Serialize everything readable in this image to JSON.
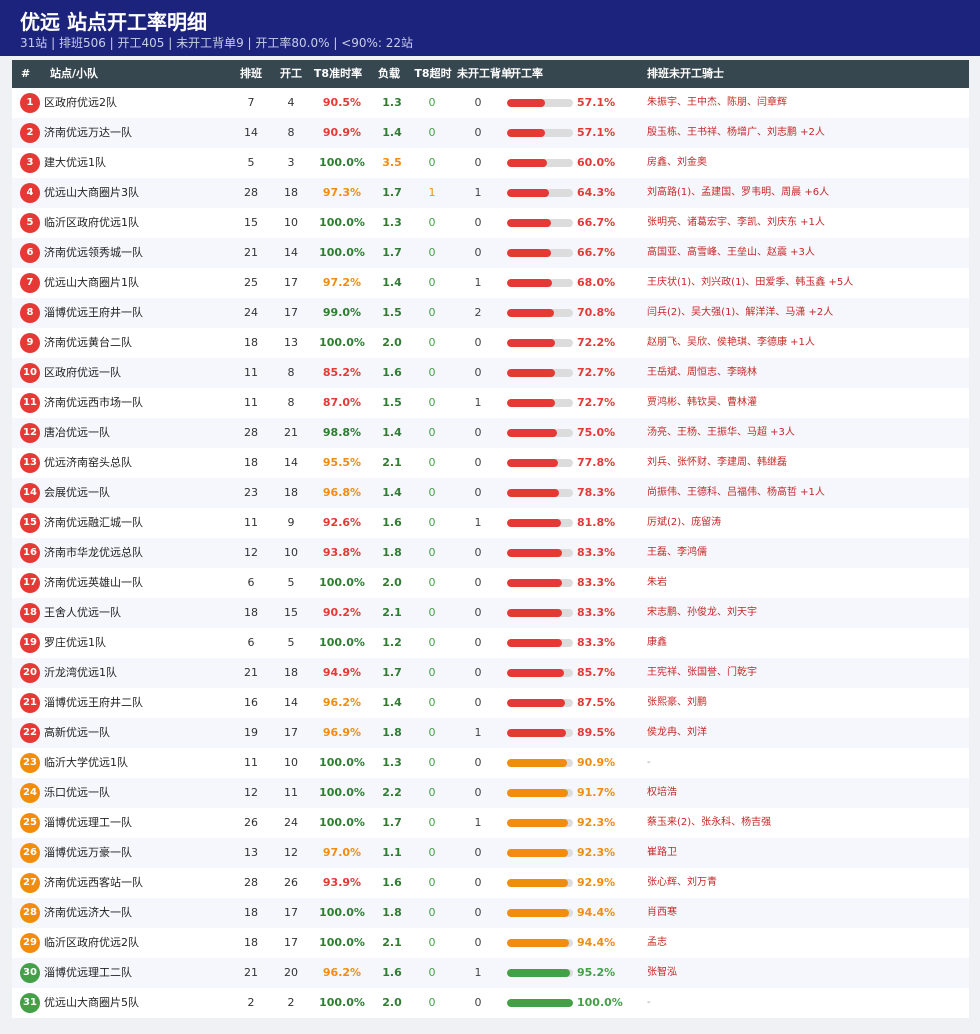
{
  "header": {
    "title": "优远  站点开工率明细",
    "subtitle": "31站 | 排班506 | 开工405 | 未开工背单9 | 开工率80.0% | <90%: 22站"
  },
  "columns": [
    "#",
    "站点/小队",
    "排班",
    "开工",
    "T8准时率",
    "负载",
    "T8超时",
    "未开工背单",
    "开工率",
    "排班未开工骑士"
  ],
  "colors": {
    "red": "#e53935",
    "orange": "#f28c0f",
    "green": "#43a047",
    "dark_green": "#2e7d32",
    "header_bg": "#1b237c",
    "thead_bg": "#37474f"
  },
  "rows": [
    {
      "rank": "1",
      "name": "区政府优远2队",
      "shift": "7",
      "start": "4",
      "t8": "90.5%",
      "load": "1.3",
      "over": "0",
      "nostart": "0",
      "rate": "57.1%",
      "rate_value": 57.1,
      "riders": "朱振宇、王中杰、陈朋、闫章辉"
    },
    {
      "rank": "2",
      "name": "济南优远万达一队",
      "shift": "14",
      "start": "8",
      "t8": "90.9%",
      "load": "1.4",
      "over": "0",
      "nostart": "0",
      "rate": "57.1%",
      "rate_value": 57.1,
      "riders": "殷玉栋、王书祥、杨增广、刘志鹏 +2人"
    },
    {
      "rank": "3",
      "name": "建大优远1队",
      "shift": "5",
      "start": "3",
      "t8": "100.0%",
      "load": "3.5",
      "over": "0",
      "nostart": "0",
      "rate": "60.0%",
      "rate_value": 60.0,
      "riders": "房鑫、刘金奥"
    },
    {
      "rank": "4",
      "name": "优远山大商圈片3队",
      "shift": "28",
      "start": "18",
      "t8": "97.3%",
      "load": "1.7",
      "over": "1",
      "nostart": "1",
      "rate": "64.3%",
      "rate_value": 64.3,
      "riders": "刘高路(1)、孟建国、罗韦明、周晨 +6人"
    },
    {
      "rank": "5",
      "name": "临沂区政府优远1队",
      "shift": "15",
      "start": "10",
      "t8": "100.0%",
      "load": "1.3",
      "over": "0",
      "nostart": "0",
      "rate": "66.7%",
      "rate_value": 66.7,
      "riders": "张明亮、诸葛宏宇、李凯、刘庆东 +1人"
    },
    {
      "rank": "6",
      "name": "济南优远领秀城一队",
      "shift": "21",
      "start": "14",
      "t8": "100.0%",
      "load": "1.7",
      "over": "0",
      "nostart": "0",
      "rate": "66.7%",
      "rate_value": 66.7,
      "riders": "高国亚、高雪峰、王垒山、赵震 +3人"
    },
    {
      "rank": "7",
      "name": "优远山大商圈片1队",
      "shift": "25",
      "start": "17",
      "t8": "97.2%",
      "load": "1.4",
      "over": "0",
      "nostart": "1",
      "rate": "68.0%",
      "rate_value": 68.0,
      "riders": "王庆状(1)、刘兴政(1)、田爱季、韩玉鑫 +5人"
    },
    {
      "rank": "8",
      "name": "淄博优远王府井一队",
      "shift": "24",
      "start": "17",
      "t8": "99.0%",
      "load": "1.5",
      "over": "0",
      "nostart": "2",
      "rate": "70.8%",
      "rate_value": 70.8,
      "riders": "闫兵(2)、吴大强(1)、解洋洋、马潇 +2人"
    },
    {
      "rank": "9",
      "name": "济南优远黄台二队",
      "shift": "18",
      "start": "13",
      "t8": "100.0%",
      "load": "2.0",
      "over": "0",
      "nostart": "0",
      "rate": "72.2%",
      "rate_value": 72.2,
      "riders": "赵朋飞、吴欣、侯艳琪、李德康 +1人"
    },
    {
      "rank": "10",
      "name": "区政府优远一队",
      "shift": "11",
      "start": "8",
      "t8": "85.2%",
      "load": "1.6",
      "over": "0",
      "nostart": "0",
      "rate": "72.7%",
      "rate_value": 72.7,
      "riders": "王岳斌、周恒志、李晓林"
    },
    {
      "rank": "11",
      "name": "济南优远西市场一队",
      "shift": "11",
      "start": "8",
      "t8": "87.0%",
      "load": "1.5",
      "over": "0",
      "nostart": "1",
      "rate": "72.7%",
      "rate_value": 72.7,
      "riders": "贾鸿彬、韩钦昊、曹林灌"
    },
    {
      "rank": "12",
      "name": "唐冶优远一队",
      "shift": "28",
      "start": "21",
      "t8": "98.8%",
      "load": "1.4",
      "over": "0",
      "nostart": "0",
      "rate": "75.0%",
      "rate_value": 75.0,
      "riders": "汤亮、王杨、王振华、马超 +3人"
    },
    {
      "rank": "13",
      "name": "优远济南窑头总队",
      "shift": "18",
      "start": "14",
      "t8": "95.5%",
      "load": "2.1",
      "over": "0",
      "nostart": "0",
      "rate": "77.8%",
      "rate_value": 77.8,
      "riders": "刘兵、张怀财、李建周、韩继磊"
    },
    {
      "rank": "14",
      "name": "会展优远一队",
      "shift": "23",
      "start": "18",
      "t8": "96.8%",
      "load": "1.4",
      "over": "0",
      "nostart": "0",
      "rate": "78.3%",
      "rate_value": 78.3,
      "riders": "尚振伟、王德科、吕福伟、杨高哲 +1人"
    },
    {
      "rank": "15",
      "name": "济南优远融汇城一队",
      "shift": "11",
      "start": "9",
      "t8": "92.6%",
      "load": "1.6",
      "over": "0",
      "nostart": "1",
      "rate": "81.8%",
      "rate_value": 81.8,
      "riders": "厉斌(2)、庞留涛"
    },
    {
      "rank": "16",
      "name": "济南市华龙优远总队",
      "shift": "12",
      "start": "10",
      "t8": "93.8%",
      "load": "1.8",
      "over": "0",
      "nostart": "0",
      "rate": "83.3%",
      "rate_value": 83.3,
      "riders": "王磊、李鸿儒"
    },
    {
      "rank": "17",
      "name": "济南优远英雄山一队",
      "shift": "6",
      "start": "5",
      "t8": "100.0%",
      "load": "2.0",
      "over": "0",
      "nostart": "0",
      "rate": "83.3%",
      "rate_value": 83.3,
      "riders": "朱岩"
    },
    {
      "rank": "18",
      "name": "王舍人优远一队",
      "shift": "18",
      "start": "15",
      "t8": "90.2%",
      "load": "2.1",
      "over": "0",
      "nostart": "0",
      "rate": "83.3%",
      "rate_value": 83.3,
      "riders": "宋志鹏、孙俊龙、刘天宇"
    },
    {
      "rank": "19",
      "name": "罗庄优远1队",
      "shift": "6",
      "start": "5",
      "t8": "100.0%",
      "load": "1.2",
      "over": "0",
      "nostart": "0",
      "rate": "83.3%",
      "rate_value": 83.3,
      "riders": "康鑫"
    },
    {
      "rank": "20",
      "name": "沂龙湾优远1队",
      "shift": "21",
      "start": "18",
      "t8": "94.9%",
      "load": "1.7",
      "over": "0",
      "nostart": "0",
      "rate": "85.7%",
      "rate_value": 85.7,
      "riders": "王宪祥、张国誉、门乾宇"
    },
    {
      "rank": "21",
      "name": "淄博优远王府井二队",
      "shift": "16",
      "start": "14",
      "t8": "96.2%",
      "load": "1.4",
      "over": "0",
      "nostart": "0",
      "rate": "87.5%",
      "rate_value": 87.5,
      "riders": "张熙豪、刘鹏"
    },
    {
      "rank": "22",
      "name": "高新优远一队",
      "shift": "19",
      "start": "17",
      "t8": "96.9%",
      "load": "1.8",
      "over": "0",
      "nostart": "1",
      "rate": "89.5%",
      "rate_value": 89.5,
      "riders": "侯龙冉、刘洋"
    },
    {
      "rank": "23",
      "name": "临沂大学优远1队",
      "shift": "11",
      "start": "10",
      "t8": "100.0%",
      "load": "1.3",
      "over": "0",
      "nostart": "0",
      "rate": "90.9%",
      "rate_value": 90.9,
      "riders": "-"
    },
    {
      "rank": "24",
      "name": "泺口优远一队",
      "shift": "12",
      "start": "11",
      "t8": "100.0%",
      "load": "2.2",
      "over": "0",
      "nostart": "0",
      "rate": "91.7%",
      "rate_value": 91.7,
      "riders": "权培浩"
    },
    {
      "rank": "25",
      "name": "淄博优远理工一队",
      "shift": "26",
      "start": "24",
      "t8": "100.0%",
      "load": "1.7",
      "over": "0",
      "nostart": "1",
      "rate": "92.3%",
      "rate_value": 92.3,
      "riders": "蔡玉来(2)、张永科、杨吉强"
    },
    {
      "rank": "26",
      "name": "淄博优远万豪一队",
      "shift": "13",
      "start": "12",
      "t8": "97.0%",
      "load": "1.1",
      "over": "0",
      "nostart": "0",
      "rate": "92.3%",
      "rate_value": 92.3,
      "riders": "崔路卫"
    },
    {
      "rank": "27",
      "name": "济南优远西客站一队",
      "shift": "28",
      "start": "26",
      "t8": "93.9%",
      "load": "1.6",
      "over": "0",
      "nostart": "0",
      "rate": "92.9%",
      "rate_value": 92.9,
      "riders": "张心辉、刘万青"
    },
    {
      "rank": "28",
      "name": "济南优远济大一队",
      "shift": "18",
      "start": "17",
      "t8": "100.0%",
      "load": "1.8",
      "over": "0",
      "nostart": "0",
      "rate": "94.4%",
      "rate_value": 94.4,
      "riders": "肖西寒"
    },
    {
      "rank": "29",
      "name": "临沂区政府优远2队",
      "shift": "18",
      "start": "17",
      "t8": "100.0%",
      "load": "2.1",
      "over": "0",
      "nostart": "0",
      "rate": "94.4%",
      "rate_value": 94.4,
      "riders": "孟志"
    },
    {
      "rank": "30",
      "name": "淄博优远理工二队",
      "shift": "21",
      "start": "20",
      "t8": "96.2%",
      "load": "1.6",
      "over": "0",
      "nostart": "1",
      "rate": "95.2%",
      "rate_value": 95.2,
      "riders": "张智泓"
    },
    {
      "rank": "31",
      "name": "优远山大商圈片5队",
      "shift": "2",
      "start": "2",
      "t8": "100.0%",
      "load": "2.0",
      "over": "0",
      "nostart": "0",
      "rate": "100.0%",
      "rate_value": 100.0,
      "riders": "-"
    }
  ]
}
